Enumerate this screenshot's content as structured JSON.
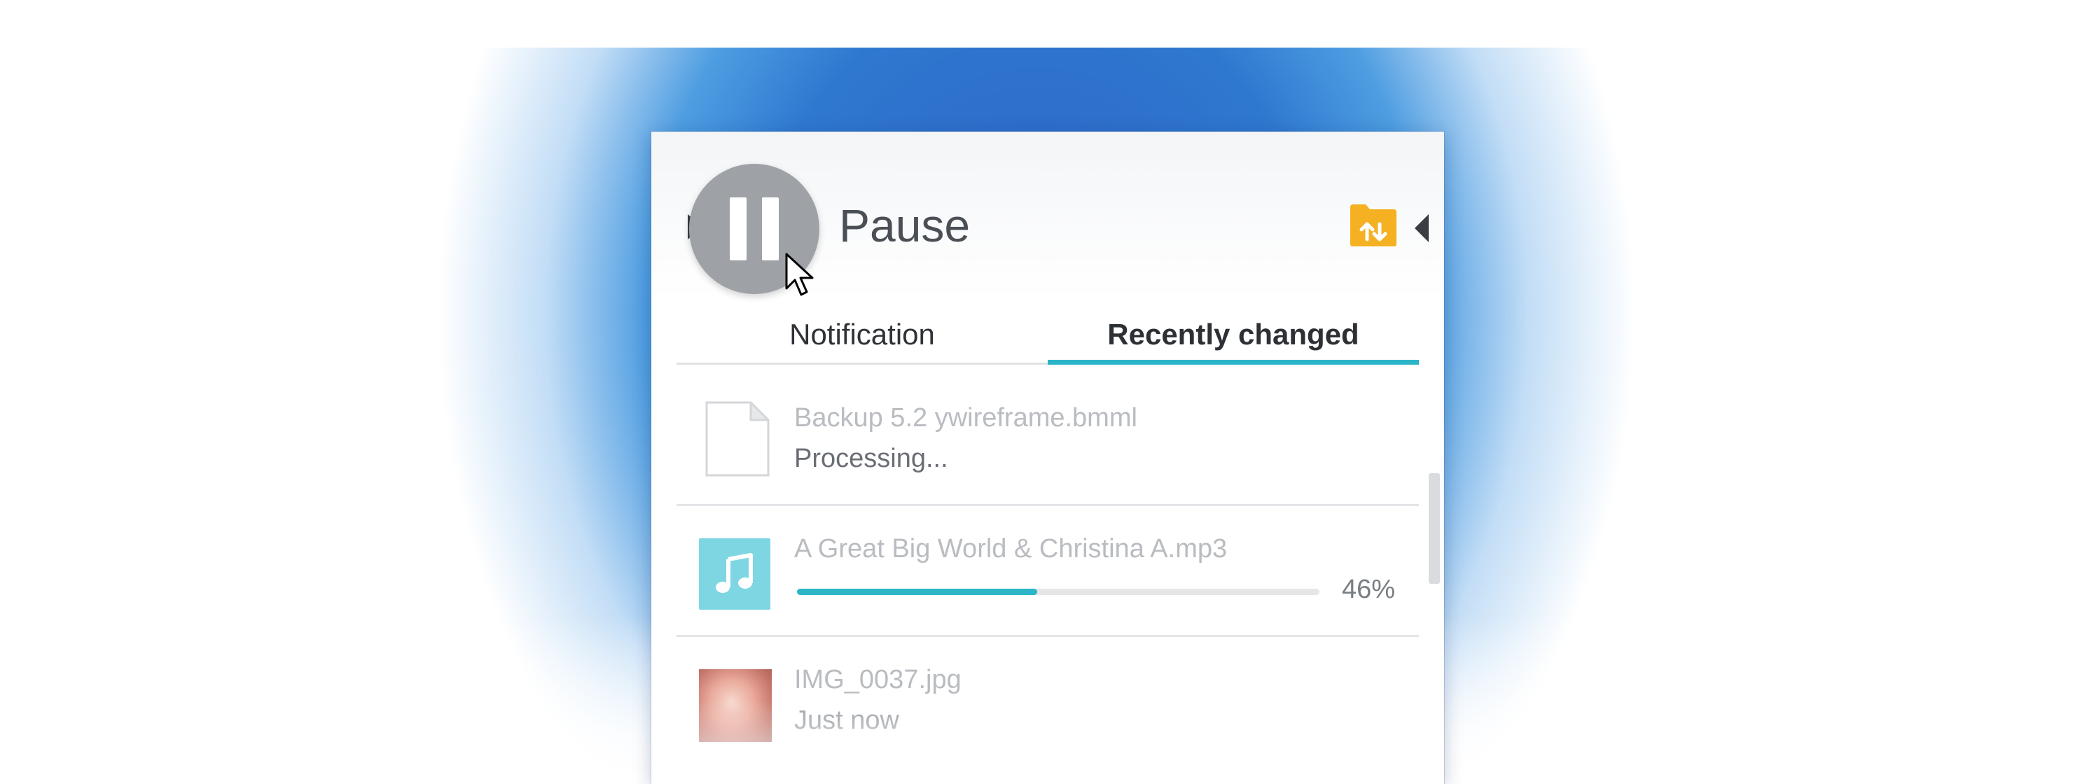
{
  "header": {
    "pause_label": "Pause"
  },
  "tabs": [
    {
      "label": "Notification",
      "active": false
    },
    {
      "label": "Recently changed",
      "active": true
    }
  ],
  "items": [
    {
      "name": "Backup 5.2 ywireframe.bmml",
      "status": "Processing...",
      "icon": "document-icon"
    },
    {
      "name": "A Great Big World & Christina A.mp3",
      "progress": 0.46,
      "progress_label": "46%",
      "icon": "music-note-icon"
    },
    {
      "name": "IMG_0037.jpg",
      "status": "Just now",
      "icon": "image-thumbnail"
    }
  ],
  "colors": {
    "accent": "#2bb5c7",
    "folder": "#f5b122",
    "pause_button": "#9ea1a6",
    "music_tile": "#7fd6e3",
    "background_blue": "#2c63c6"
  }
}
